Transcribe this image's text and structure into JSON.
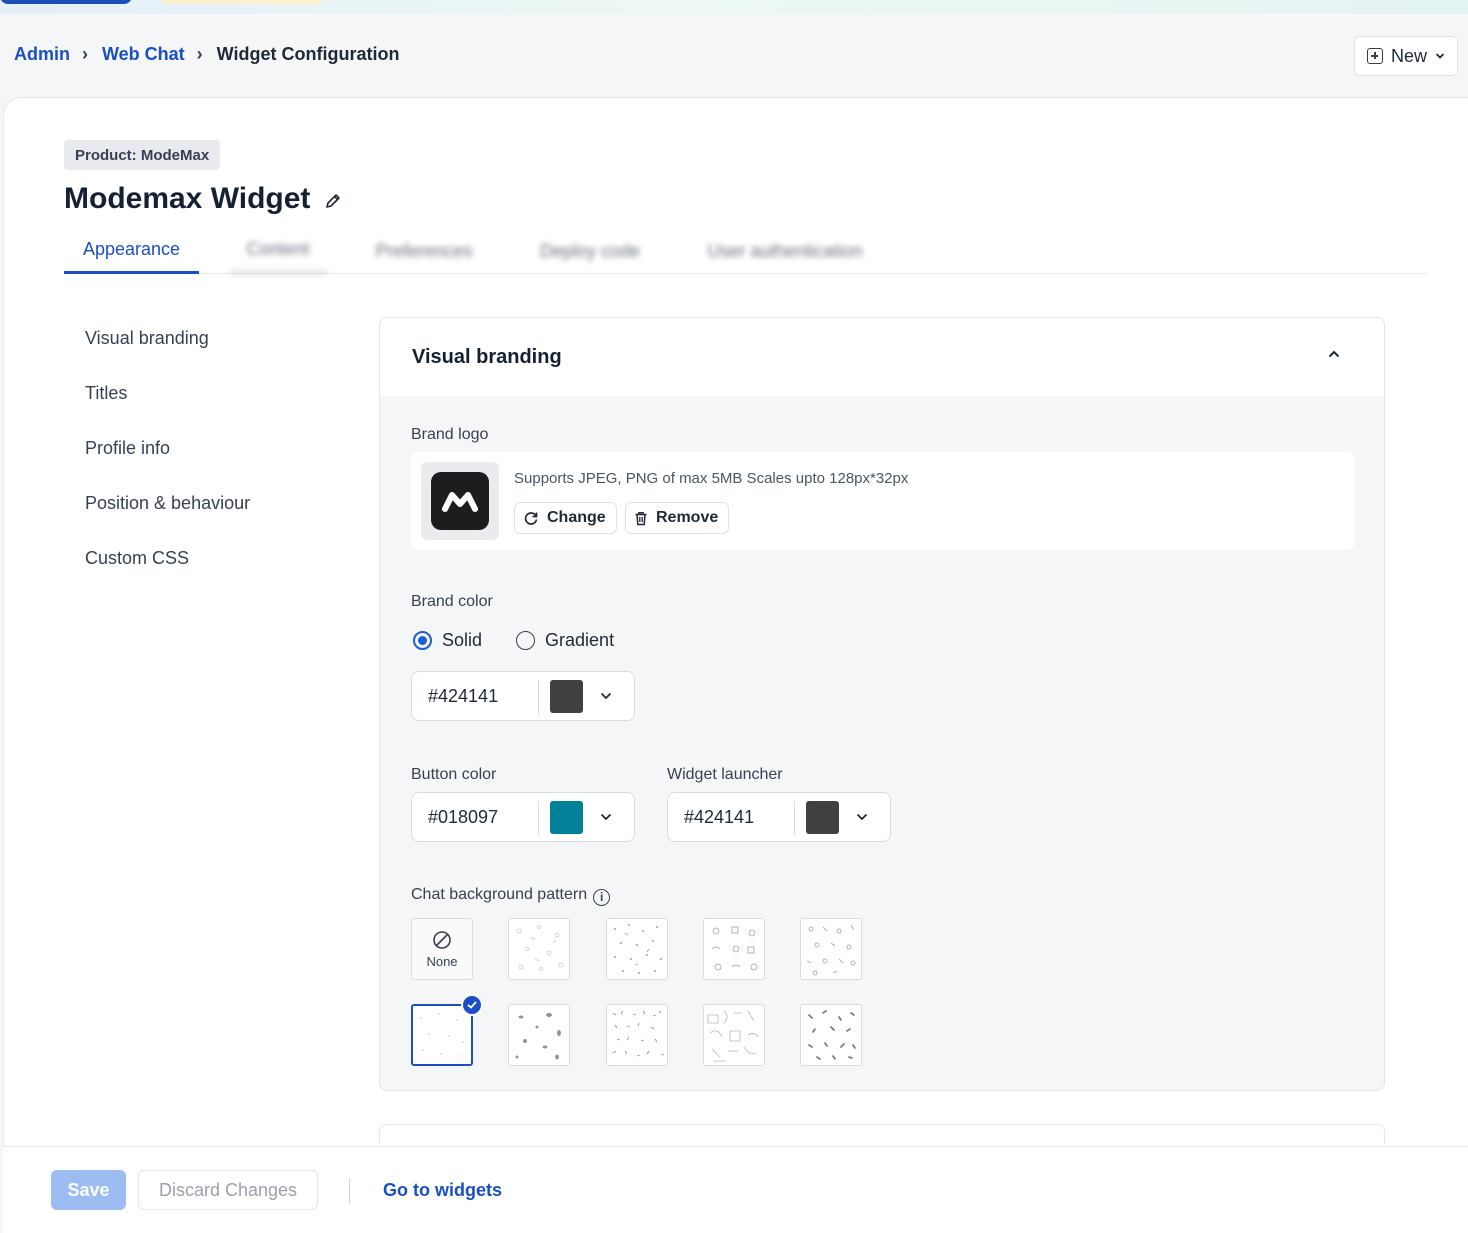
{
  "breadcrumb": {
    "items": [
      "Admin",
      "Web Chat"
    ],
    "current": "Widget Configuration"
  },
  "header": {
    "new_label": "New"
  },
  "product_badge": "Product: ModeMax",
  "widget_title": "Modemax Widget",
  "tabs": [
    {
      "label": "Appearance",
      "active": true
    },
    {
      "label": "Content"
    },
    {
      "label": "Preferences"
    },
    {
      "label": "Deploy code"
    },
    {
      "label": "User authentication"
    }
  ],
  "sidebar": {
    "items": [
      {
        "label": "Visual branding"
      },
      {
        "label": "Titles"
      },
      {
        "label": "Profile info"
      },
      {
        "label": "Position & behaviour"
      },
      {
        "label": "Custom CSS"
      }
    ]
  },
  "visual_branding": {
    "title": "Visual branding",
    "brand_logo": {
      "label": "Brand logo",
      "hint": "Supports JPEG, PNG of max 5MB Scales upto 128px*32px",
      "change_label": "Change",
      "remove_label": "Remove"
    },
    "brand_color": {
      "label": "Brand color",
      "options": [
        "Solid",
        "Gradient"
      ],
      "selected": "Solid",
      "hex": "#424141",
      "swatch": "#424141"
    },
    "button_color": {
      "label": "Button color",
      "hex": "#018097",
      "swatch": "#018097"
    },
    "widget_launcher": {
      "label": "Widget launcher",
      "hex": "#424141",
      "swatch": "#424141"
    },
    "pattern": {
      "label": "Chat background pattern",
      "none_label": "None",
      "selected_index": 5,
      "count": 10
    }
  },
  "footer": {
    "save_label": "Save",
    "discard_label": "Discard Changes",
    "goto_label": "Go to widgets"
  },
  "colors": {
    "accent": "#1a4fc4",
    "save_disabled": "#9dbcf2"
  }
}
